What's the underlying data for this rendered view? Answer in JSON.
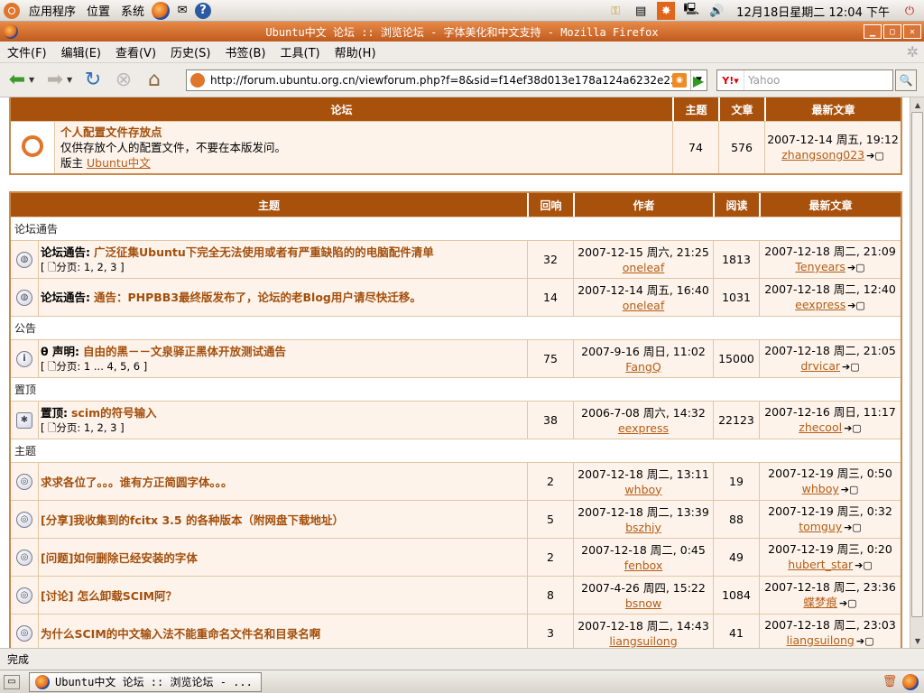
{
  "panel": {
    "menus": [
      "应用程序",
      "位置",
      "系统"
    ],
    "clock": "12月18日星期二 12:04 下午"
  },
  "window": {
    "title": "Ubuntu中文 论坛 :: 浏览论坛 - 字体美化和中文支持 - Mozilla Firefox"
  },
  "menu": [
    "文件(F)",
    "编辑(E)",
    "查看(V)",
    "历史(S)",
    "书签(B)",
    "工具(T)",
    "帮助(H)"
  ],
  "url": "http://forum.ubuntu.org.cn/viewforum.php?f=8&sid=f14ef38d013e178a124a6232e23d5",
  "search_placeholder": "Yahoo",
  "forum_table": {
    "headers": [
      "论坛",
      "主题",
      "文章",
      "最新文章"
    ],
    "row": {
      "title": "个人配置文件存放点",
      "desc": "仅供存放个人的配置文件，不要在本版发问。",
      "mod_label": "版主",
      "moderator": "Ubuntu中文",
      "topics": "74",
      "posts": "576",
      "last_time": "2007-12-14 周五, 19:12",
      "last_user": "zhangsong023"
    }
  },
  "topic_table": {
    "headers": [
      "主题",
      "回响",
      "作者",
      "阅读",
      "最新文章"
    ],
    "cat_announce": "论坛通告",
    "cat_notice": "公告",
    "cat_sticky": "置顶",
    "cat_topics": "主题",
    "rows": [
      {
        "prefix": "论坛通告:",
        "title": "广泛征集Ubuntu下完全无法使用或者有严重缺陷的的电脑配件清单",
        "pages": "[ 🗋分页: 1, 2, 3 ]",
        "replies": "32",
        "author_time": "2007-12-15 周六, 21:25",
        "author": "oneleaf",
        "views": "1813",
        "last_time": "2007-12-18 周二, 21:09",
        "last_user": "Tenyears"
      },
      {
        "prefix": "论坛通告:",
        "title": "通告：PHPBB3最终版发布了，论坛的老Blog用户请尽快迁移。",
        "pages": "",
        "replies": "14",
        "author_time": "2007-12-14 周五, 16:40",
        "author": "oneleaf",
        "views": "1031",
        "last_time": "2007-12-18 周二, 12:40",
        "last_user": "eexpress"
      },
      {
        "prefix": "θ 声明:",
        "title": "自由的黑－－文泉驿正黑体开放测试通告",
        "pages": "[ 🗋分页: 1 ... 4, 5, 6 ]",
        "replies": "75",
        "author_time": "2007-9-16 周日, 11:02",
        "author": "FangQ",
        "views": "15000",
        "last_time": "2007-12-18 周二, 21:05",
        "last_user": "drvicar"
      },
      {
        "prefix": "置顶:",
        "title": "scim的符号输入",
        "pages": "[ 🗋分页: 1, 2, 3 ]",
        "replies": "38",
        "author_time": "2006-7-08 周六, 14:32",
        "author": "eexpress",
        "views": "22123",
        "last_time": "2007-12-16 周日, 11:17",
        "last_user": "zhecool"
      },
      {
        "prefix": "",
        "title": "求求各位了。。。谁有方正简圆字体。。。",
        "pages": "",
        "replies": "2",
        "author_time": "2007-12-18 周二, 13:11",
        "author": "whboy",
        "views": "19",
        "last_time": "2007-12-19 周三, 0:50",
        "last_user": "whboy"
      },
      {
        "prefix": "",
        "title": "[分享]我收集到的fcitx 3.5 的各种版本（附网盘下载地址）",
        "pages": "",
        "replies": "5",
        "author_time": "2007-12-18 周二, 13:39",
        "author": "bszhjy",
        "views": "88",
        "last_time": "2007-12-19 周三, 0:32",
        "last_user": "tomguy"
      },
      {
        "prefix": "",
        "title": "[问题]如何删除已经安装的字体",
        "pages": "",
        "replies": "2",
        "author_time": "2007-12-18 周二, 0:45",
        "author": "fenbox",
        "views": "49",
        "last_time": "2007-12-19 周三, 0:20",
        "last_user": "hubert_star"
      },
      {
        "prefix": "",
        "title": "[讨论] 怎么卸载SCIM阿？",
        "pages": "",
        "replies": "8",
        "author_time": "2007-4-26 周四, 15:22",
        "author": "bsnow",
        "views": "1084",
        "last_time": "2007-12-18 周二, 23:36",
        "last_user": "蝶梦痕"
      },
      {
        "prefix": "",
        "title": "为什么SCIM的中文输入法不能重命名文件名和目录名啊",
        "pages": "",
        "replies": "3",
        "author_time": "2007-12-18 周二, 14:43",
        "author": "liangsuilong",
        "views": "41",
        "last_time": "2007-12-18 周二, 23:03",
        "last_user": "liangsuilong"
      }
    ]
  },
  "status": "完成",
  "taskbar_item": "Ubuntu中文 论坛 :: 浏览论坛 - ..."
}
